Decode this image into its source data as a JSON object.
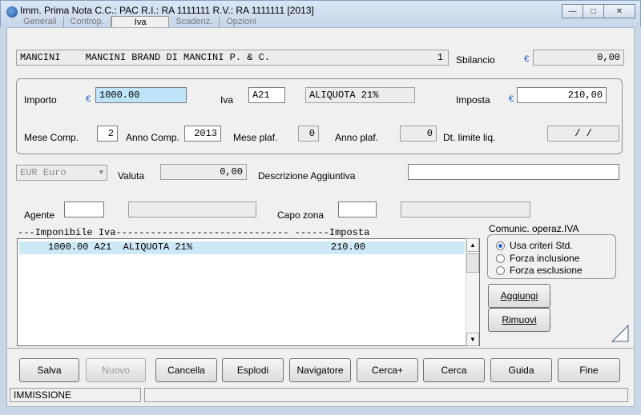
{
  "window": {
    "title": "Imm. Prima Nota C.C.: PAC  R.I.: RA  1111111 R.V.: RA  1111111 [2013]",
    "minimize_icon": "minimize-icon",
    "maximize_icon": "maximize-icon",
    "close_icon": "close-icon"
  },
  "tabs": [
    {
      "label": "Generali"
    },
    {
      "label": "Controp."
    },
    {
      "label": "Iva"
    },
    {
      "label": "Scadenz."
    },
    {
      "label": "Opzioni"
    }
  ],
  "header": {
    "client_code": "MANCINI",
    "client_name": "MANCINI BRAND DI MANCINI P. & C.",
    "counter": "1",
    "sbilancio_label": "Sbilancio",
    "sbilancio_value": "0,00"
  },
  "iva_group": {
    "importo_label": "Importo",
    "importo_value": "1000.00",
    "iva_label": "Iva",
    "iva_code": "A21",
    "iva_desc": "ALIQUOTA 21%",
    "imposta_label": "Imposta",
    "imposta_value": "210,00",
    "mese_comp_label": "Mese Comp.",
    "mese_comp_value": "2",
    "anno_comp_label": "Anno Comp.",
    "anno_comp_value": "2013",
    "mese_plaf_label": "Mese plaf.",
    "mese_plaf_value": "0",
    "anno_plaf_label": "Anno plaf.",
    "anno_plaf_value": "0",
    "dt_limite_label": "Dt. limite liq.",
    "dt_limite_value": "/  /"
  },
  "valuta": {
    "currency_select": "EUR Euro",
    "valuta_label": "Valuta",
    "valuta_value": "0,00",
    "descrizione_label": "Descrizione Aggiuntiva",
    "descrizione_value": ""
  },
  "agente": {
    "agente_label": "Agente",
    "agente_code": "",
    "agente_desc": "",
    "capo_zona_label": "Capo zona",
    "capo_zona_code": "",
    "capo_zona_desc": ""
  },
  "list": {
    "header": "---Imponibile Iva------------------------------ ------Imposta",
    "rows": [
      "     1000.00 A21  ALIQUOTA 21%                        210.00"
    ]
  },
  "comunic": {
    "title": "Comunic. operaz.IVA",
    "options": [
      "Usa criteri Std.",
      "Forza inclusione",
      "Forza esclusione"
    ],
    "selected": "Usa criteri Std."
  },
  "side_buttons": {
    "aggiungi": "Aggiungi",
    "rimuovi": "Rimuovi"
  },
  "toolbar": {
    "salva": "Salva",
    "nuovo": "Nuovo",
    "cancella": "Cancella",
    "esplodi": "Esplodi",
    "navigatore": "Navigatore",
    "cerca_plus": "Cerca+",
    "cerca": "Cerca",
    "guida": "Guida",
    "fine": "Fine"
  },
  "status": {
    "mode": "IMMISSIONE",
    "message": ""
  },
  "colors": {
    "highlight": "#bfe3f8",
    "euro": "#1a55c4"
  }
}
